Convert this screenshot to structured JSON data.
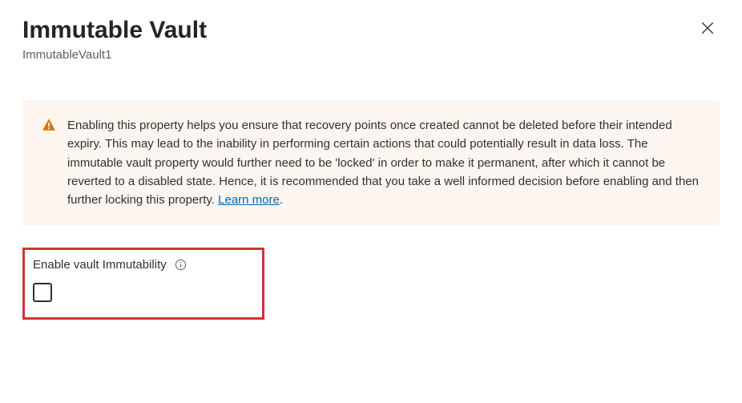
{
  "header": {
    "title": "Immutable Vault",
    "subtitle": "ImmutableVault1"
  },
  "banner": {
    "text": "Enabling this property helps you ensure that recovery points once created cannot be deleted before their intended expiry. This may lead to the inability in performing certain actions that could potentially result in data loss. The immutable vault property would further need to be 'locked' in order to make it permanent, after which it cannot be reverted to a disabled state. Hence, it is recommended that you take a well informed decision before enabling and then further locking this property. ",
    "learn_more_label": "Learn more"
  },
  "field": {
    "label": "Enable vault Immutability",
    "checked": false
  }
}
